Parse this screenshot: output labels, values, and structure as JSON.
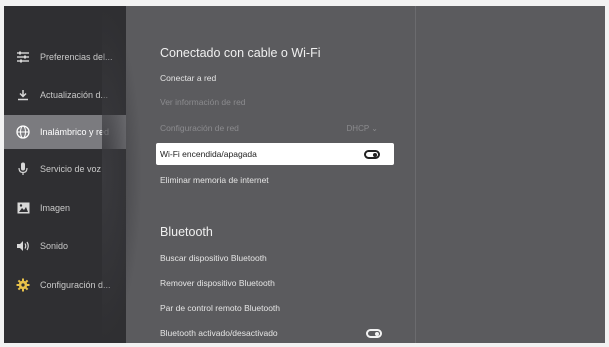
{
  "sidebar": {
    "items": [
      {
        "label": "Preferencias del...",
        "icon": "preferences-icon"
      },
      {
        "label": "Actualización d...",
        "icon": "download-icon"
      },
      {
        "label": "Inalámbrico y red",
        "icon": "globe-network-icon"
      },
      {
        "label": "Servicio de voz",
        "icon": "microphone-icon"
      },
      {
        "label": "Imagen",
        "icon": "image-icon"
      },
      {
        "label": "Sonido",
        "icon": "speaker-icon"
      },
      {
        "label": "Configuración d...",
        "icon": "gear-icon"
      }
    ]
  },
  "network": {
    "title": "Conectado con cable o Wi-Fi",
    "connect": "Conectar a red",
    "view_info": "Ver información de red",
    "config": "Configuración de red",
    "config_value": "DHCP",
    "wifi_toggle": "Wi-Fi encendida/apagada",
    "clear_memory": "Eliminar memoria de internet"
  },
  "bluetooth": {
    "title": "Bluetooth",
    "search": "Buscar dispositivo Bluetooth",
    "remove": "Remover dispositivo Bluetooth",
    "pair_remote": "Par de control remoto Bluetooth",
    "toggle": "Bluetooth activado/desactivado"
  }
}
